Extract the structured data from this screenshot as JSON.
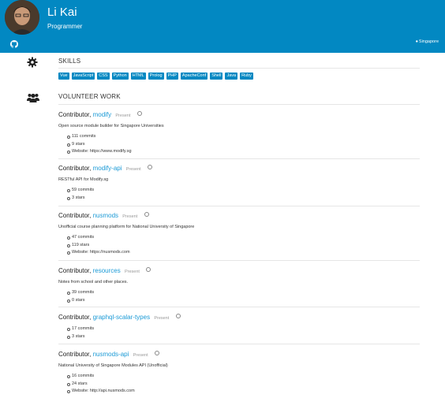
{
  "profile": {
    "name": "Li Kai",
    "role": "Programmer",
    "location": "Singapore"
  },
  "skills": {
    "title": "SKILLS",
    "tags": [
      "Vue",
      "JavaScript",
      "CSS",
      "Python",
      "HTML",
      "Prolog",
      "PHP",
      "ApacheConf",
      "Shell",
      "Java",
      "Ruby"
    ]
  },
  "volunteer": {
    "title": "VOLUNTEER WORK",
    "entries": [
      {
        "position": "Contributor,",
        "project": "modify",
        "status": "Present",
        "description": "Open source module builder for Singapore Universities",
        "stats": [
          "111 commits",
          "9 stars",
          "Website: https://www.modify.sg"
        ]
      },
      {
        "position": "Contributor,",
        "project": "modify-api",
        "status": "Present",
        "description": "RESTful API for Modify.sg",
        "stats": [
          "59 commits",
          "3 stars"
        ]
      },
      {
        "position": "Contributor,",
        "project": "nusmods",
        "status": "Present",
        "description": "Unofficial course planning platform for National University of Singapore",
        "stats": [
          "47 commits",
          "119 stars",
          "Website: https://nusmods.com"
        ]
      },
      {
        "position": "Contributor,",
        "project": "resources",
        "status": "Present",
        "description": "Notes from school and other places.",
        "stats": [
          "39 commits",
          "0 stars"
        ]
      },
      {
        "position": "Contributor,",
        "project": "graphql-scalar-types",
        "status": "Present",
        "description": "",
        "stats": [
          "17 commits",
          "3 stars"
        ]
      },
      {
        "position": "Contributor,",
        "project": "nusmods-api",
        "status": "Present",
        "description": "National University of Singapore Modules API (Unofficial)",
        "stats": [
          "16 commits",
          "24 stars",
          "Website: http://api.nusmods.com"
        ]
      }
    ]
  },
  "colors": {
    "header": "#0288c2",
    "link": "#1b9ad6",
    "muted": "#999999"
  }
}
